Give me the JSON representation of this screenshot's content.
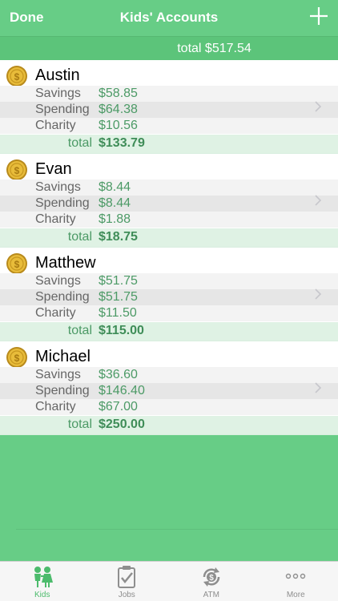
{
  "navbar": {
    "done_label": "Done",
    "title": "Kids' Accounts"
  },
  "summary": {
    "total_text": "total $517.54"
  },
  "labels": {
    "savings": "Savings",
    "spending": "Spending",
    "charity": "Charity",
    "total": "total"
  },
  "kids": [
    {
      "name": "Austin",
      "savings": "$58.85",
      "spending": "$64.38",
      "charity": "$10.56",
      "total": "$133.79"
    },
    {
      "name": "Evan",
      "savings": "$8.44",
      "spending": "$8.44",
      "charity": "$1.88",
      "total": "$18.75"
    },
    {
      "name": "Matthew",
      "savings": "$51.75",
      "spending": "$51.75",
      "charity": "$11.50",
      "total": "$115.00"
    },
    {
      "name": "Michael",
      "savings": "$36.60",
      "spending": "$146.40",
      "charity": "$67.00",
      "total": "$250.00"
    }
  ],
  "tabs": [
    {
      "label": "Kids",
      "icon": "kids-icon",
      "active": true
    },
    {
      "label": "Jobs",
      "icon": "clipboard-check-icon",
      "active": false
    },
    {
      "label": "ATM",
      "icon": "atm-icon",
      "active": false
    },
    {
      "label": "More",
      "icon": "more-dots-icon",
      "active": false
    }
  ],
  "colors": {
    "brand_green": "#67cd86",
    "amount_green": "#4c9a66",
    "tab_active": "#4cbb6c"
  }
}
